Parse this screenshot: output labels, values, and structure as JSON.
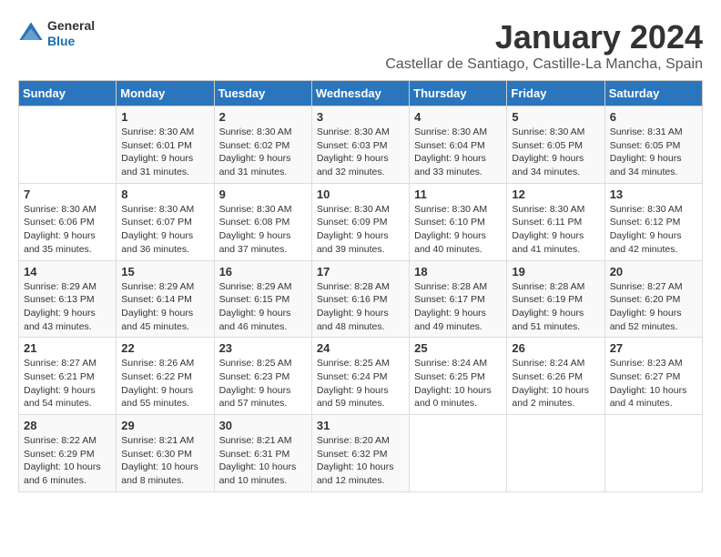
{
  "logo": {
    "line1": "General",
    "line2": "Blue"
  },
  "title": "January 2024",
  "subtitle": "Castellar de Santiago, Castille-La Mancha, Spain",
  "days_of_week": [
    "Sunday",
    "Monday",
    "Tuesday",
    "Wednesday",
    "Thursday",
    "Friday",
    "Saturday"
  ],
  "weeks": [
    [
      {
        "day": "",
        "info": ""
      },
      {
        "day": "1",
        "info": "Sunrise: 8:30 AM\nSunset: 6:01 PM\nDaylight: 9 hours\nand 31 minutes."
      },
      {
        "day": "2",
        "info": "Sunrise: 8:30 AM\nSunset: 6:02 PM\nDaylight: 9 hours\nand 31 minutes."
      },
      {
        "day": "3",
        "info": "Sunrise: 8:30 AM\nSunset: 6:03 PM\nDaylight: 9 hours\nand 32 minutes."
      },
      {
        "day": "4",
        "info": "Sunrise: 8:30 AM\nSunset: 6:04 PM\nDaylight: 9 hours\nand 33 minutes."
      },
      {
        "day": "5",
        "info": "Sunrise: 8:30 AM\nSunset: 6:05 PM\nDaylight: 9 hours\nand 34 minutes."
      },
      {
        "day": "6",
        "info": "Sunrise: 8:31 AM\nSunset: 6:05 PM\nDaylight: 9 hours\nand 34 minutes."
      }
    ],
    [
      {
        "day": "7",
        "info": "Sunrise: 8:30 AM\nSunset: 6:06 PM\nDaylight: 9 hours\nand 35 minutes."
      },
      {
        "day": "8",
        "info": "Sunrise: 8:30 AM\nSunset: 6:07 PM\nDaylight: 9 hours\nand 36 minutes."
      },
      {
        "day": "9",
        "info": "Sunrise: 8:30 AM\nSunset: 6:08 PM\nDaylight: 9 hours\nand 37 minutes."
      },
      {
        "day": "10",
        "info": "Sunrise: 8:30 AM\nSunset: 6:09 PM\nDaylight: 9 hours\nand 39 minutes."
      },
      {
        "day": "11",
        "info": "Sunrise: 8:30 AM\nSunset: 6:10 PM\nDaylight: 9 hours\nand 40 minutes."
      },
      {
        "day": "12",
        "info": "Sunrise: 8:30 AM\nSunset: 6:11 PM\nDaylight: 9 hours\nand 41 minutes."
      },
      {
        "day": "13",
        "info": "Sunrise: 8:30 AM\nSunset: 6:12 PM\nDaylight: 9 hours\nand 42 minutes."
      }
    ],
    [
      {
        "day": "14",
        "info": "Sunrise: 8:29 AM\nSunset: 6:13 PM\nDaylight: 9 hours\nand 43 minutes."
      },
      {
        "day": "15",
        "info": "Sunrise: 8:29 AM\nSunset: 6:14 PM\nDaylight: 9 hours\nand 45 minutes."
      },
      {
        "day": "16",
        "info": "Sunrise: 8:29 AM\nSunset: 6:15 PM\nDaylight: 9 hours\nand 46 minutes."
      },
      {
        "day": "17",
        "info": "Sunrise: 8:28 AM\nSunset: 6:16 PM\nDaylight: 9 hours\nand 48 minutes."
      },
      {
        "day": "18",
        "info": "Sunrise: 8:28 AM\nSunset: 6:17 PM\nDaylight: 9 hours\nand 49 minutes."
      },
      {
        "day": "19",
        "info": "Sunrise: 8:28 AM\nSunset: 6:19 PM\nDaylight: 9 hours\nand 51 minutes."
      },
      {
        "day": "20",
        "info": "Sunrise: 8:27 AM\nSunset: 6:20 PM\nDaylight: 9 hours\nand 52 minutes."
      }
    ],
    [
      {
        "day": "21",
        "info": "Sunrise: 8:27 AM\nSunset: 6:21 PM\nDaylight: 9 hours\nand 54 minutes."
      },
      {
        "day": "22",
        "info": "Sunrise: 8:26 AM\nSunset: 6:22 PM\nDaylight: 9 hours\nand 55 minutes."
      },
      {
        "day": "23",
        "info": "Sunrise: 8:25 AM\nSunset: 6:23 PM\nDaylight: 9 hours\nand 57 minutes."
      },
      {
        "day": "24",
        "info": "Sunrise: 8:25 AM\nSunset: 6:24 PM\nDaylight: 9 hours\nand 59 minutes."
      },
      {
        "day": "25",
        "info": "Sunrise: 8:24 AM\nSunset: 6:25 PM\nDaylight: 10 hours\nand 0 minutes."
      },
      {
        "day": "26",
        "info": "Sunrise: 8:24 AM\nSunset: 6:26 PM\nDaylight: 10 hours\nand 2 minutes."
      },
      {
        "day": "27",
        "info": "Sunrise: 8:23 AM\nSunset: 6:27 PM\nDaylight: 10 hours\nand 4 minutes."
      }
    ],
    [
      {
        "day": "28",
        "info": "Sunrise: 8:22 AM\nSunset: 6:29 PM\nDaylight: 10 hours\nand 6 minutes."
      },
      {
        "day": "29",
        "info": "Sunrise: 8:21 AM\nSunset: 6:30 PM\nDaylight: 10 hours\nand 8 minutes."
      },
      {
        "day": "30",
        "info": "Sunrise: 8:21 AM\nSunset: 6:31 PM\nDaylight: 10 hours\nand 10 minutes."
      },
      {
        "day": "31",
        "info": "Sunrise: 8:20 AM\nSunset: 6:32 PM\nDaylight: 10 hours\nand 12 minutes."
      },
      {
        "day": "",
        "info": ""
      },
      {
        "day": "",
        "info": ""
      },
      {
        "day": "",
        "info": ""
      }
    ]
  ]
}
